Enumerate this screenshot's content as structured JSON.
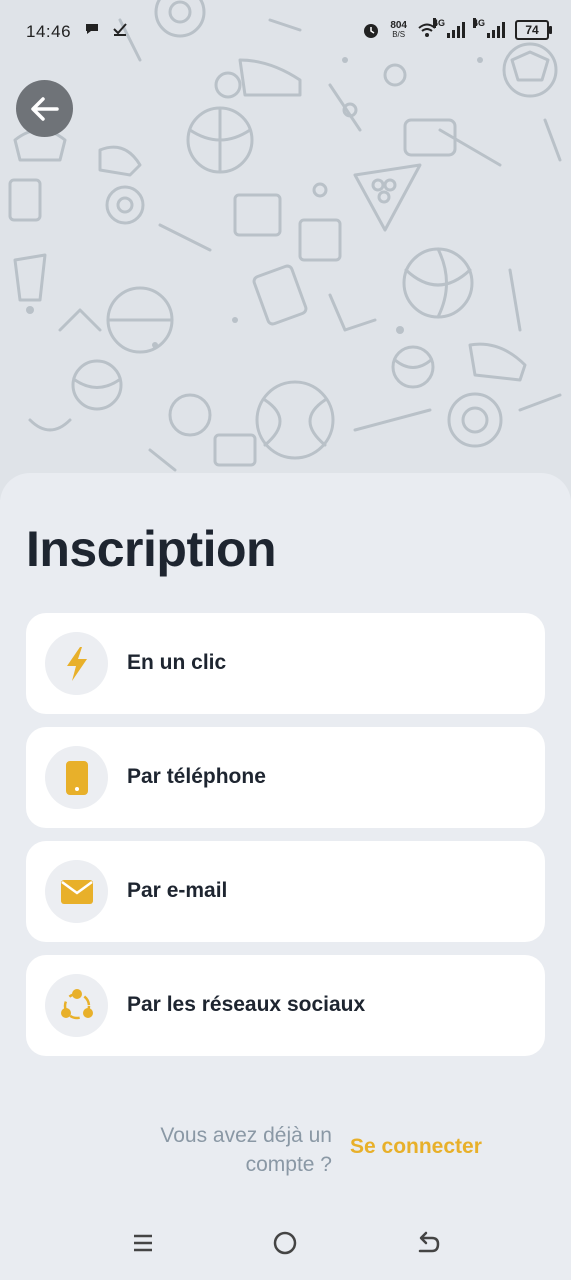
{
  "status_bar": {
    "time": "14:46",
    "net_speed_value": "804",
    "net_speed_unit": "B/S",
    "sim1_label": "4G",
    "sim2_label": "4G",
    "battery": "74"
  },
  "page": {
    "title": "Inscription"
  },
  "options": [
    {
      "label": "En un clic",
      "icon": "lightning-icon"
    },
    {
      "label": "Par téléphone",
      "icon": "phone-icon"
    },
    {
      "label": "Par e-mail",
      "icon": "envelope-icon"
    },
    {
      "label": "Par les réseaux sociaux",
      "icon": "social-network-icon"
    }
  ],
  "footer": {
    "prompt_line1": "Vous avez déjà un",
    "prompt_line2": "compte ?",
    "login_label": "Se connecter"
  },
  "colors": {
    "accent": "#e8b02a",
    "background": "#e9ecf1",
    "card": "#ffffff",
    "title_text": "#1e2530",
    "muted_text": "#8a98a5"
  }
}
